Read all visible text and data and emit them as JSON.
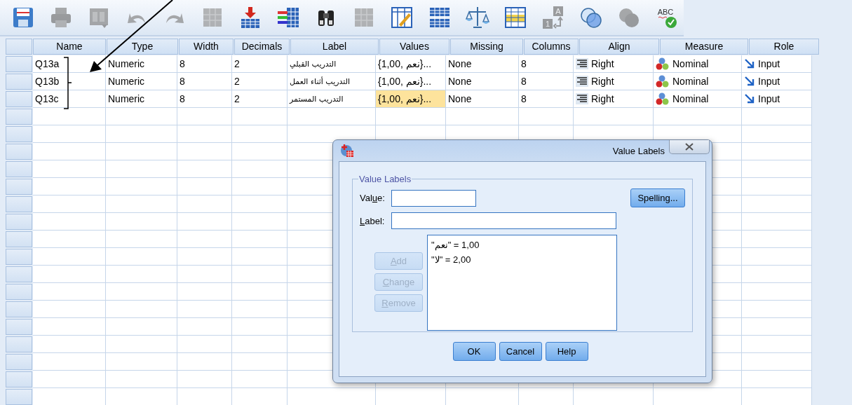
{
  "toolbar": [
    {
      "kind": "save",
      "disabled": false
    },
    {
      "kind": "print",
      "disabled": true
    },
    {
      "kind": "recall",
      "disabled": true
    },
    {
      "kind": "undo",
      "disabled": true
    },
    {
      "kind": "redo",
      "disabled": true
    },
    {
      "kind": "goto-case",
      "disabled": true
    },
    {
      "kind": "goto-variable",
      "disabled": false
    },
    {
      "kind": "variables",
      "disabled": false
    },
    {
      "kind": "find",
      "disabled": false
    },
    {
      "kind": "insert-cases",
      "disabled": true
    },
    {
      "kind": "insert-variable",
      "disabled": false
    },
    {
      "kind": "split-file",
      "disabled": false
    },
    {
      "kind": "weight",
      "disabled": false
    },
    {
      "kind": "select-cases",
      "disabled": false
    },
    {
      "kind": "value-labels",
      "disabled": true,
      "text": [
        "A",
        "1"
      ]
    },
    {
      "kind": "use-sets",
      "disabled": false
    },
    {
      "kind": "show-all",
      "disabled": true
    },
    {
      "kind": "spelling",
      "disabled": false,
      "text": [
        "ABC"
      ]
    }
  ],
  "table": {
    "columns": [
      {
        "label": "Name",
        "kind": "text"
      },
      {
        "label": "Type",
        "kind": "text"
      },
      {
        "label": "Width",
        "kind": "text"
      },
      {
        "label": "Decimals",
        "kind": "text"
      },
      {
        "label": "Label",
        "kind": "arabic"
      },
      {
        "label": "Values",
        "kind": "text"
      },
      {
        "label": "Missing",
        "kind": "text"
      },
      {
        "label": "Columns",
        "kind": "text"
      },
      {
        "label": "Align",
        "kind": "align"
      },
      {
        "label": "Measure",
        "kind": "measure"
      },
      {
        "label": "Role",
        "kind": "role"
      }
    ],
    "rows": [
      {
        "cells": [
          {
            "text": "Q13a",
            "selected": false
          },
          {
            "text": "Numeric",
            "selected": false
          },
          {
            "text": "8",
            "selected": false
          },
          {
            "text": "2",
            "selected": false
          },
          {
            "text": "التدريب القبلي",
            "selected": false
          },
          {
            "text": "{1,00, نعم}...",
            "selected": false
          },
          {
            "text": "None",
            "selected": false
          },
          {
            "text": "8",
            "selected": false
          },
          {
            "text": "Right",
            "selected": false
          },
          {
            "text": "Nominal",
            "selected": false
          },
          {
            "text": "Input",
            "selected": false
          }
        ]
      },
      {
        "cells": [
          {
            "text": "Q13b",
            "selected": false
          },
          {
            "text": "Numeric",
            "selected": false
          },
          {
            "text": "8",
            "selected": false
          },
          {
            "text": "2",
            "selected": false
          },
          {
            "text": "التدريب أثناء العمل",
            "selected": false
          },
          {
            "text": "{1,00, نعم}...",
            "selected": false
          },
          {
            "text": "None",
            "selected": false
          },
          {
            "text": "8",
            "selected": false
          },
          {
            "text": "Right",
            "selected": false
          },
          {
            "text": "Nominal",
            "selected": false
          },
          {
            "text": "Input",
            "selected": false
          }
        ]
      },
      {
        "cells": [
          {
            "text": "Q13c",
            "selected": false
          },
          {
            "text": "Numeric",
            "selected": false
          },
          {
            "text": "8",
            "selected": false
          },
          {
            "text": "2",
            "selected": false
          },
          {
            "text": "التدريب المستمر",
            "selected": false
          },
          {
            "text": "{1,00, نعم}...",
            "selected": true
          },
          {
            "text": "None",
            "selected": false
          },
          {
            "text": "8",
            "selected": false
          },
          {
            "text": "Right",
            "selected": false
          },
          {
            "text": "Nominal",
            "selected": false
          },
          {
            "text": "Input",
            "selected": false
          }
        ]
      }
    ]
  },
  "dialog": {
    "title": "Value Labels",
    "group": "Value Labels",
    "value_field": {
      "before": "Val",
      "key": "u",
      "after": "e:"
    },
    "label_field": {
      "key": "L",
      "after": "abel:"
    },
    "spelling_button": "Spelling...",
    "list_items": [
      "\"نعم\" = 1,00",
      "\"لا\" = 2,00"
    ],
    "side_buttons": [
      {
        "key": "A",
        "after": "dd",
        "disabled": true
      },
      {
        "key": "C",
        "after": "hange",
        "disabled": true
      },
      {
        "key": "R",
        "after": "emove",
        "disabled": true
      }
    ],
    "buttons": [
      "OK",
      "Cancel",
      "Help"
    ]
  }
}
